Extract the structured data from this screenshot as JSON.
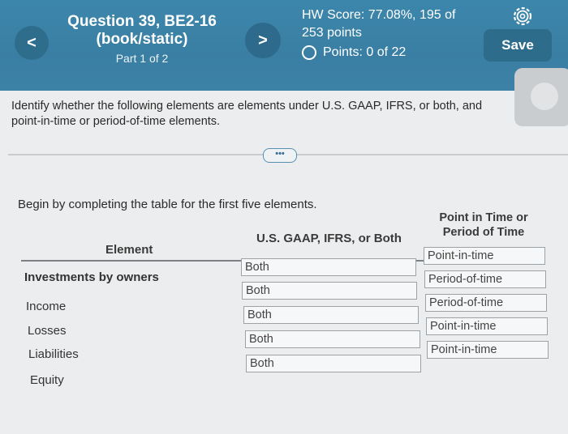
{
  "header": {
    "question_title": "Question 39, BE2-16 (book/static)",
    "part": "Part 1 of 2",
    "hw_score": "HW Score: 77.08%, 195 of 253 points",
    "points": "Points: 0 of 22",
    "save_label": "Save",
    "back_glyph": "<",
    "next_glyph": ">"
  },
  "instructions": "Identify whether the following elements are elements under U.S. GAAP, IFRS, or both, and point-in-time or period-of-time elements.",
  "expand_label": "•••",
  "begin_text": "Begin by completing the table for the first five elements.",
  "table": {
    "col_element": "Element",
    "col_gaap": "U.S. GAAP, IFRS, or Both",
    "col_time": "Point in Time or Period of Time",
    "rows": [
      {
        "element": "Investments by owners",
        "gaap": "Both",
        "time": "Point-in-time"
      },
      {
        "element": "Income",
        "gaap": "Both",
        "time": "Period-of-time"
      },
      {
        "element": "Losses",
        "gaap": "Both",
        "time": "Period-of-time"
      },
      {
        "element": "Liabilities",
        "gaap": "Both",
        "time": "Point-in-time"
      },
      {
        "element": "Equity",
        "gaap": "Both",
        "time": "Point-in-time"
      }
    ]
  },
  "icons": {
    "settings": "gear-icon",
    "radio": "radio-empty-icon"
  },
  "colors": {
    "header": "#3c86ab",
    "button": "#2e6c8c"
  }
}
